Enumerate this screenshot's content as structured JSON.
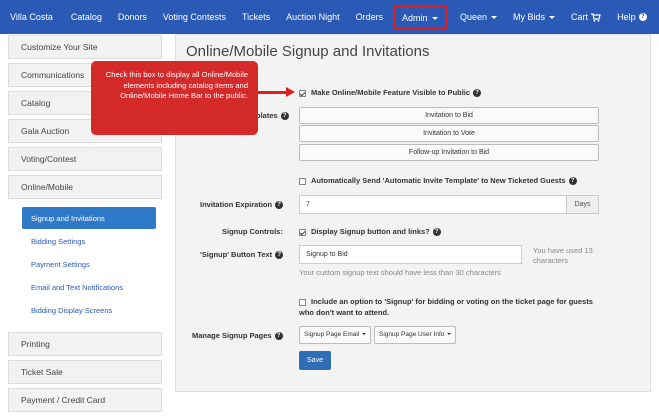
{
  "nav": {
    "brand": "Villa Costa",
    "items": [
      "Catalog",
      "Donors",
      "Voting Contests",
      "Tickets",
      "Auction Night",
      "Orders"
    ],
    "admin": "Admin",
    "queen": "Queen",
    "my_bids": "My Bids",
    "cart": "Cart",
    "help": "Help"
  },
  "sidebar": {
    "items": [
      "Customize Your Site",
      "Communications",
      "Catalog",
      "Gala Auction",
      "Voting/Contest",
      "Online/Mobile"
    ],
    "sub_items": [
      "Signup and Invitations",
      "Bidding Settings",
      "Payment Settings",
      "Email and Text Notifications",
      "Bidding Display Screens"
    ],
    "bottom_items": [
      "Printing",
      "Ticket Sale",
      "Payment / Credit Card"
    ]
  },
  "main": {
    "title": "Online/Mobile Signup and Invitations",
    "make_visible_label": "Make Online/Mobile Feature Visible to Public",
    "templates_label": "plates",
    "invite_buttons": [
      "Invitation to Bid",
      "Invitation to Vote",
      "Follow-up Invitation to Bid"
    ],
    "auto_send_label": "Automatically Send 'Automatic Invite Template' to New Ticketed Guests",
    "expiration_label": "Invitation Expiration",
    "expiration_value": "7",
    "expiration_unit": "Days",
    "signup_controls_label": "Signup Controls:",
    "display_signup_label": "Display Signup button and links?",
    "signup_text_label": "'Signup' Button Text",
    "signup_text_value": "Signup to Bid",
    "used_count": "You have used 13 characters",
    "signup_hint": "Your custom signup text should have less than 30 characters",
    "include_option_label": "Include an option to 'Signup' for bidding or voting on the ticket page for guests who don't want to attend.",
    "manage_pages_label": "Manage Signup Pages",
    "signup_page_email": "Signup Page Email",
    "signup_page_user_info": "Signup Page User Info",
    "save": "Save"
  },
  "callout": {
    "text": "Check this box to display all Online/Mobile elements including catalog items and Online/Mobile Home Bar to the public."
  }
}
